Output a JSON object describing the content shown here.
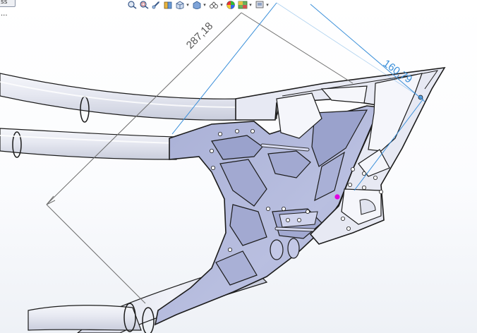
{
  "window": {
    "tab_label": "ss",
    "menu_dots": "..."
  },
  "toolbar": {
    "buttons": [
      {
        "name": "zoom-to-fit-icon"
      },
      {
        "name": "zoom-to-area-icon"
      },
      {
        "name": "previous-view-icon"
      },
      {
        "name": "section-view-icon"
      },
      {
        "name": "view-orientation-icon"
      },
      {
        "name": "display-style-icon"
      },
      {
        "name": "hide-show-items-icon"
      },
      {
        "name": "edit-appearance-icon"
      },
      {
        "name": "apply-scene-icon"
      },
      {
        "name": "view-settings-icon"
      }
    ]
  },
  "dimensions": {
    "diagonal": {
      "value": "287,18",
      "color": "#6e6e6e"
    },
    "tip": {
      "value": "160,79",
      "color": "#3a8fd9"
    }
  },
  "colors": {
    "part_face": "#b8bedf",
    "part_face_dark": "#9ea6cf",
    "tube": "#eef0f7",
    "edge": "#1b1b1b",
    "origin_marker": "#e100e1"
  }
}
